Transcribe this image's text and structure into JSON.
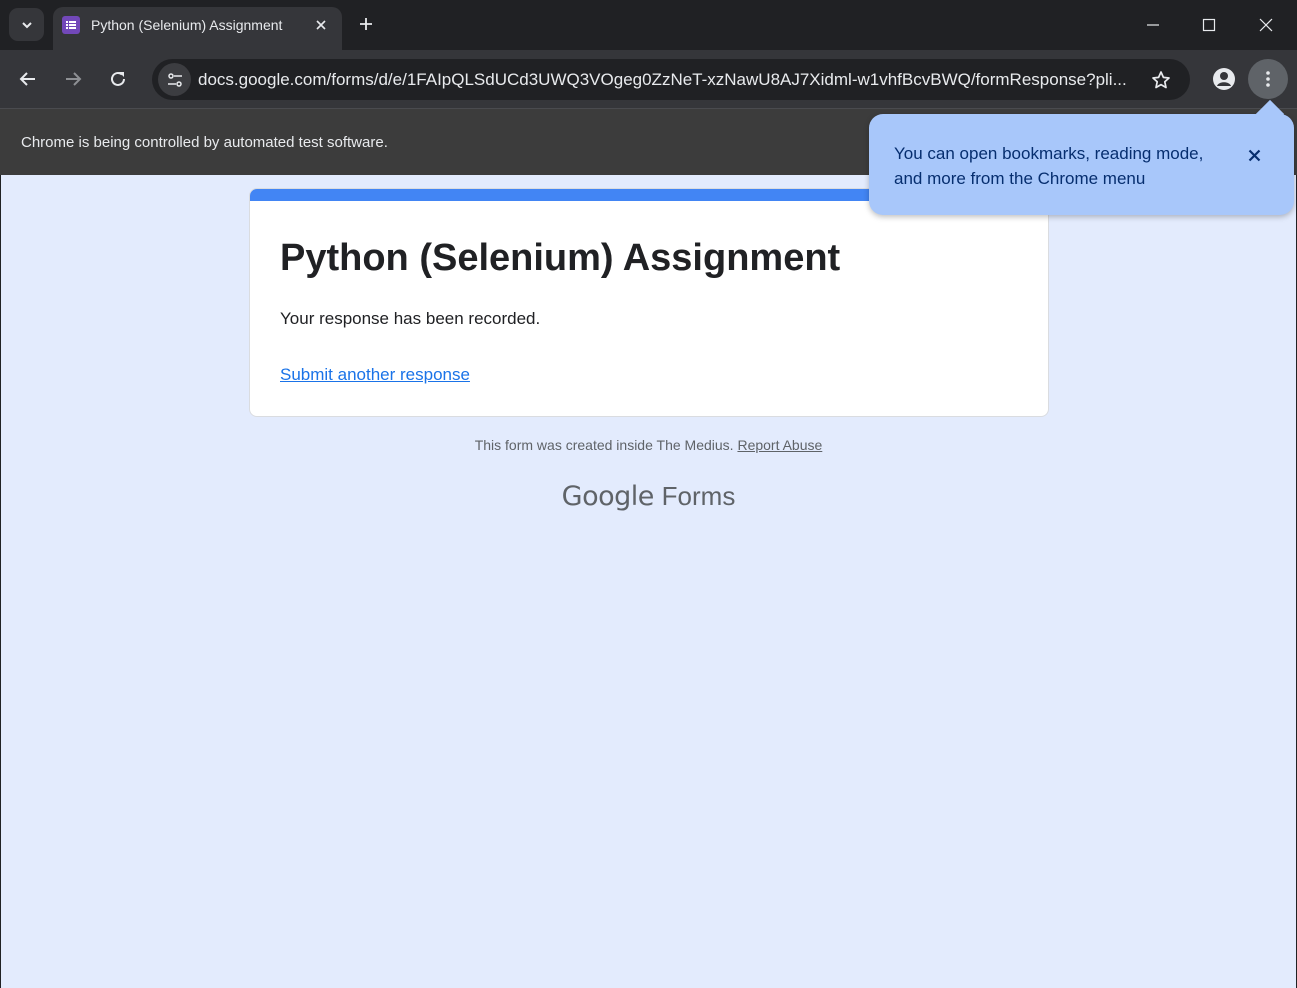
{
  "browser": {
    "tab": {
      "title": "Python (Selenium) Assignment",
      "favicon_icon": "google-forms-icon",
      "favicon_color": "#7248b9"
    },
    "address_bar": {
      "url": "docs.google.com/forms/d/e/1FAIpQLSdUCd3UWQ3VOgeg0ZzNeT-xzNawU8AJ7Xidml-w1vhfBcvBWQ/formResponse?pli..."
    },
    "infobar": {
      "message": "Chrome is being controlled by automated test software."
    },
    "menu_bubble": {
      "text": "You can open bookmarks, reading mode, and more from the Chrome menu"
    }
  },
  "form": {
    "title": "Python (Selenium) Assignment",
    "confirmation": "Your response has been recorded.",
    "submit_another": "Submit another response",
    "accent_color": "#4285f4"
  },
  "footer": {
    "note": "This form was created inside The Medius.",
    "report_abuse": "Report Abuse",
    "brand_google": "Google",
    "brand_forms": "Forms"
  }
}
